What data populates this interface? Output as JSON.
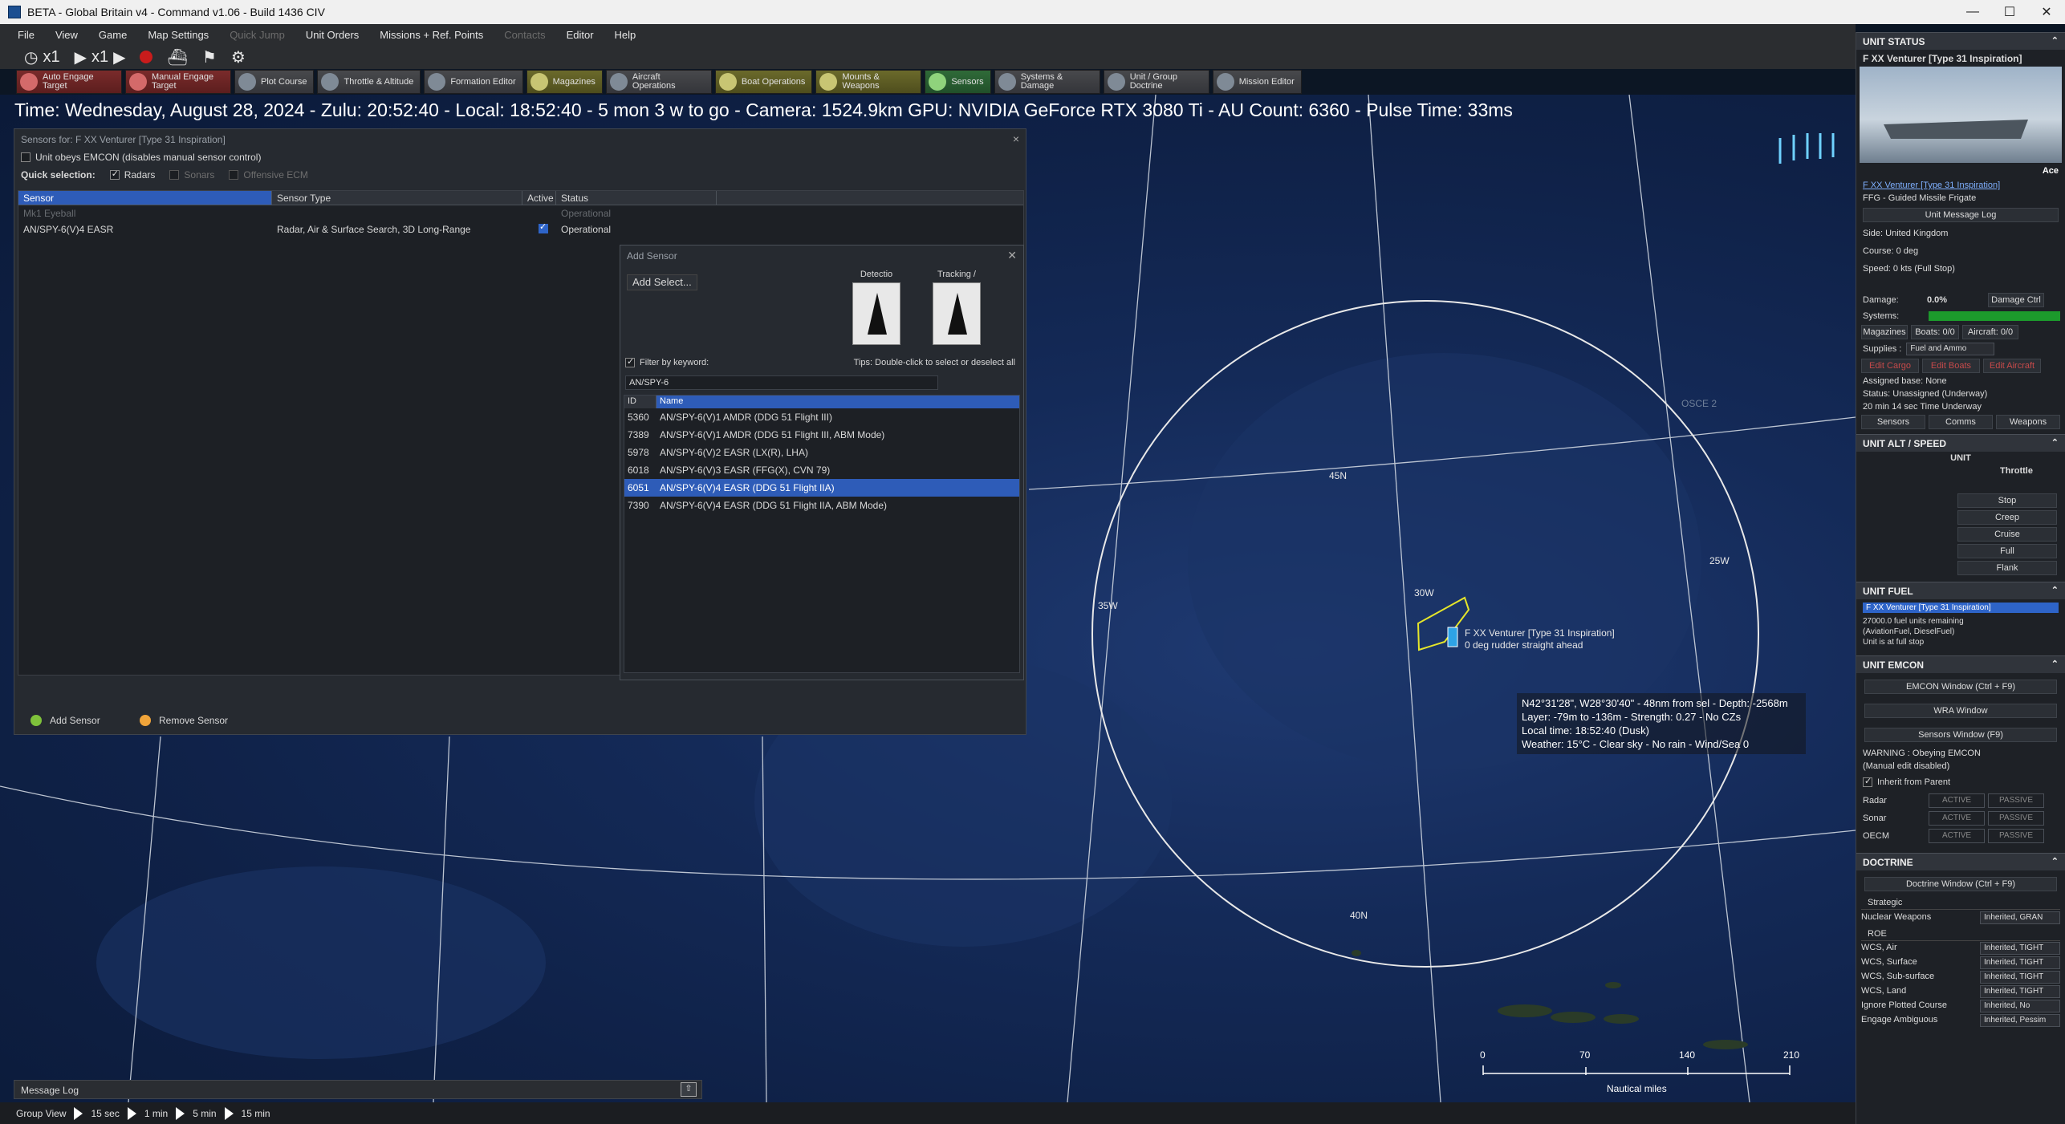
{
  "window": {
    "title": "BETA - Global Britain v4 - Command v1.06 - Build 1436 CIV",
    "controls": [
      "—",
      "☐",
      "✕"
    ]
  },
  "menu": [
    "File",
    "View",
    "Game",
    "Map Settings",
    "Quick Jump",
    "Unit Orders",
    "Missions + Ref. Points",
    "Contacts",
    "Editor",
    "Help"
  ],
  "menu_disabled": [
    "Quick Jump",
    "Contacts"
  ],
  "controls": {
    "speed1": "x1",
    "speed2": "x1"
  },
  "toolbar": [
    {
      "label": "Auto Engage Target",
      "style": "red"
    },
    {
      "label": "Manual Engage Target",
      "style": "red"
    },
    {
      "label": "Plot Course",
      "style": ""
    },
    {
      "label": "Throttle & Altitude",
      "style": ""
    },
    {
      "label": "Formation Editor",
      "style": ""
    },
    {
      "label": "Magazines",
      "style": "olive"
    },
    {
      "label": "Aircraft Operations",
      "style": ""
    },
    {
      "label": "Boat Operations",
      "style": "olive"
    },
    {
      "label": "Mounts & Weapons",
      "style": "olive"
    },
    {
      "label": "Sensors",
      "style": "green"
    },
    {
      "label": "Systems & Damage",
      "style": ""
    },
    {
      "label": "Unit / Group Doctrine",
      "style": ""
    },
    {
      "label": "Mission Editor",
      "style": ""
    }
  ],
  "infoline": "Time: Wednesday, August 28, 2024 - Zulu: 20:52:40 - Local: 18:52:40 - 5 mon 3 w to go - Camera: 1524.9km GPU: NVIDIA GeForce RTX 3080 Ti - AU Count: 6360 - Pulse Time: 33ms",
  "sensors_window": {
    "title": "Sensors for: F XX Venturer [Type 31 Inspiration]",
    "emcon_label": "Unit obeys EMCON (disables manual sensor control)",
    "quick_selection_label": "Quick selection:",
    "quick": [
      {
        "label": "Radars",
        "checked": true,
        "disabled": false
      },
      {
        "label": "Sonars",
        "checked": false,
        "disabled": true
      },
      {
        "label": "Offensive ECM",
        "checked": false,
        "disabled": true
      }
    ],
    "columns": [
      "Sensor",
      "Sensor Type",
      "Active",
      "Status"
    ],
    "rows": [
      {
        "sensor": "Mk1 Eyeball",
        "type": "",
        "active": false,
        "status": "Operational",
        "dim": true
      },
      {
        "sensor": "AN/SPY-6(V)4 EASR",
        "type": "Radar, Air & Surface Search, 3D Long-Range",
        "active": true,
        "status": "Operational",
        "dim": false
      }
    ],
    "add_sensor": "Add Sensor",
    "remove_sensor": "Remove Sensor"
  },
  "add_window": {
    "title": "Add Sensor",
    "add_select": "Add Select...",
    "detection_label": "Detectio",
    "tracking_label": "Tracking /",
    "filter_label": "Filter by keyword:",
    "tips": "Tips: Double-click to select or deselect all",
    "keyword": "AN/SPY-6",
    "columns": [
      "ID",
      "Name"
    ],
    "items": [
      {
        "id": "5360",
        "name": "AN/SPY-6(V)1 AMDR (DDG 51 Flight III)",
        "selected": false
      },
      {
        "id": "7389",
        "name": "AN/SPY-6(V)1 AMDR (DDG 51 Flight III, ABM Mode)",
        "selected": false
      },
      {
        "id": "5978",
        "name": "AN/SPY-6(V)2 EASR (LX(R), LHA)",
        "selected": false
      },
      {
        "id": "6018",
        "name": "AN/SPY-6(V)3 EASR (FFG(X), CVN 79)",
        "selected": false
      },
      {
        "id": "6051",
        "name": "AN/SPY-6(V)4 EASR (DDG 51 Flight IIA)",
        "selected": true
      },
      {
        "id": "7390",
        "name": "AN/SPY-6(V)4 EASR (DDG 51 Flight IIA, ABM Mode)",
        "selected": false
      }
    ]
  },
  "map": {
    "labels": {
      "lat45": "45N",
      "lat40": "40N",
      "lon35": "35W",
      "lon30": "30W",
      "lon25": "25W",
      "ghost": "OSCE 2"
    },
    "unit_label": [
      "F XX Venturer [Type 31 Inspiration]",
      "0 deg  rudder straight ahead"
    ],
    "tooltip": [
      "N42°31'28\", W28°30'40\" - 48nm from sel - Depth: -2568m",
      "Layer: -79m to -136m - Strength: 0.27 - No CZs",
      "Local time: 18:52:40 (Dusk)",
      "Weather: 15°C - Clear sky - No rain - Wind/Sea 0"
    ],
    "scale": {
      "ticks": [
        "0",
        "70",
        "140",
        "210"
      ],
      "unit": "Nautical miles"
    }
  },
  "message_log": "Message Log",
  "group_view": {
    "label": "Group View",
    "steps": [
      "15 sec",
      "1 min",
      "5 min",
      "15 min"
    ]
  },
  "right_panel": {
    "unit_status": "UNIT STATUS",
    "unit_name": "F XX Venturer [Type 31 Inspiration]",
    "ace": "Ace",
    "unit_link": "F XX Venturer [Type 31 Inspiration]",
    "unit_class": "FFG - Guided Missile Frigate",
    "unit_message_log": "Unit Message Log",
    "side": "Side: United Kingdom",
    "course": "Course: 0 deg",
    "speed": "Speed: 0 kts (Full Stop)",
    "damage_label": "Damage:",
    "damage_value": "0.0%",
    "damage_ctrl": "Damage Ctrl",
    "systems_label": "Systems:",
    "magazines": "Magazines",
    "boats": "Boats: 0/0",
    "aircraft": "Aircraft: 0/0",
    "supplies_label": "Supplies :",
    "supplies_value": "Fuel and Ammo",
    "edit_cargo": "Edit Cargo",
    "edit_boats": "Edit Boats",
    "edit_aircraft": "Edit Aircraft",
    "assigned": [
      "Assigned base: None",
      "Status: Unassigned (Underway)",
      "20 min 14 sec Time Underway"
    ],
    "tabs": [
      "Sensors",
      "Comms",
      "Weapons"
    ],
    "alt_speed": "UNIT ALT / SPEED",
    "unit_word": "UNIT",
    "throttle": "Throttle",
    "throttle_btns": [
      "Stop",
      "Creep",
      "Cruise",
      "Full",
      "Flank"
    ],
    "fuel": "UNIT FUEL",
    "fuel_unit": "F XX Venturer [Type 31 Inspiration]",
    "fuel_text": [
      "27000.0 fuel units remaining",
      "(AviationFuel, DieselFuel)",
      "Unit is at full stop"
    ],
    "emcon": "UNIT EMCON",
    "emcon_btns": [
      "EMCON Window (Ctrl + F9)",
      "WRA Window",
      "Sensors Window (F9)"
    ],
    "warning": [
      "WARNING : Obeying EMCON",
      "(Manual edit disabled)"
    ],
    "inherit": "Inherit from Parent",
    "emcon_rows": [
      "Radar",
      "Sonar",
      "OECM"
    ],
    "active": "ACTIVE",
    "passive": "PASSIVE",
    "doctrine": "DOCTRINE",
    "doctrine_window": "Doctrine Window (Ctrl + F9)",
    "strategic": "Strategic",
    "nuclear_label": "Nuclear Weapons",
    "nuclear_value": "Inherited, GRAN",
    "roe": "ROE",
    "roe_rows": [
      {
        "label": "WCS, Air",
        "value": "Inherited, TIGHT"
      },
      {
        "label": "WCS, Surface",
        "value": "Inherited, TIGHT"
      },
      {
        "label": "WCS, Sub-surface",
        "value": "Inherited, TIGHT"
      },
      {
        "label": "WCS, Land",
        "value": "Inherited, TIGHT"
      },
      {
        "label": "Ignore Plotted Course",
        "value": "Inherited, No"
      },
      {
        "label": "Engage Ambiguous",
        "value": "Inherited, Pessim"
      }
    ]
  },
  "colors": {
    "accent": "#2e5cb8",
    "ocean": "#142a58",
    "range_ring": "#e8e8e8",
    "unit_yellow": "#e5e52a"
  }
}
